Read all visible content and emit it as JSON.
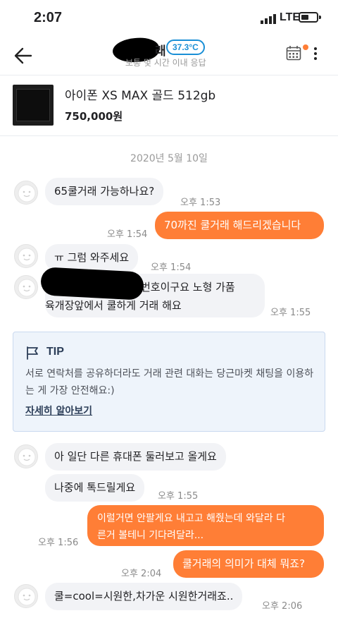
{
  "status_bar": {
    "time": "2:07",
    "network": "LTE"
  },
  "header": {
    "name_tail": "래",
    "temperature": "37.3°C",
    "response_info": "보통 몇 시간 이내 응답"
  },
  "product": {
    "title": "아이폰 XS MAX 골드 512gb",
    "price": "750,000원"
  },
  "date_separator": "2020년 5월 10일",
  "messages": [
    {
      "side": "in",
      "text": "65쿨거래 가능하나요?",
      "time": "오후 1:53"
    },
    {
      "side": "out",
      "text": "70까진 쿨거래 해드리겠습니다",
      "time": "오후 1:54"
    },
    {
      "side": "in",
      "text": "ㅠ 그럼 와주세요",
      "time": "오후 1:54"
    },
    {
      "side": "in",
      "line1": "번호이구요 노형 가품",
      "line2": "육개장앞에서 쿨하게 거래 해요",
      "time": "오후 1:55"
    },
    {
      "side": "in",
      "text": "아 일단 다른 휴대폰 둘러보고 올게요"
    },
    {
      "side": "in",
      "text": "나중에 톡드릴게요",
      "time": "오후 1:55"
    },
    {
      "side": "out",
      "line1": "이럴거면 안팔게요 내고고 해줬는데 와달라 다",
      "line2": "른거 볼테니 기다려달라...",
      "time": "오후 1:56"
    },
    {
      "side": "out",
      "text": "쿨거래의 의미가 대체 뭐죠?",
      "time": "오후 2:04"
    },
    {
      "side": "in",
      "text": "쿨=cool=시원한,차가운 시원한거래죠..",
      "time": "오후 2:06"
    }
  ],
  "tip": {
    "title": "TIP",
    "body": "서로 연락처를 공유하더라도 거래 관련 대화는 당근마켓 채팅을 이용하는 게 가장 안전해요:)",
    "link": "자세히 알아보기"
  },
  "colors": {
    "accent_orange": "#ff7e36",
    "temp_blue": "#1a8fd6",
    "bubble_gray": "#f2f3f6"
  },
  "icons": [
    "back-arrow-icon",
    "calendar-icon",
    "more-vertical-icon",
    "flag-icon",
    "signal-icon",
    "battery-icon"
  ]
}
